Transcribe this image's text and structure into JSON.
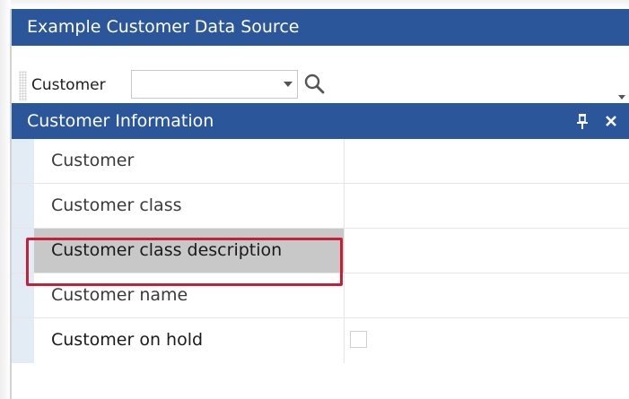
{
  "window": {
    "title": "Example Customer Data Source"
  },
  "toolbar": {
    "label": "Customer",
    "combo_value": "",
    "icons": [
      "chevron-down-icon",
      "search-icon",
      "overflow-chevron-icon"
    ]
  },
  "section": {
    "title": "Customer Information",
    "icons": [
      "pin-icon",
      "close-icon"
    ]
  },
  "fields": [
    {
      "label": "Customer",
      "value": "",
      "selected": false
    },
    {
      "label": "Customer class",
      "value": "",
      "selected": false
    },
    {
      "label": "Customer class description",
      "value": "",
      "selected": true
    },
    {
      "label": "Customer name",
      "value": "",
      "selected": false
    },
    {
      "label": "Customer on hold",
      "value": "",
      "type": "checkbox",
      "checked": false
    }
  ],
  "colors": {
    "header_blue": "#2b579a",
    "selection_gray": "#c8c8c8",
    "highlight_red": "#c4203a",
    "row_indicator": "#e3ebf5"
  }
}
